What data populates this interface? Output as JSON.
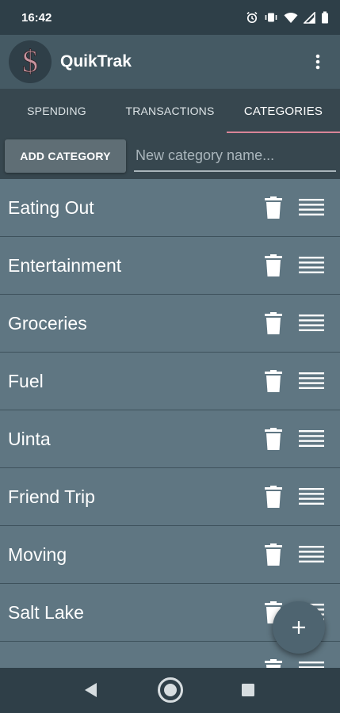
{
  "status_bar": {
    "time": "16:42"
  },
  "app_bar": {
    "title": "QuikTrak",
    "logo_symbol": "$"
  },
  "tabs": [
    {
      "label": "SPENDING",
      "active": false
    },
    {
      "label": "TRANSACTIONS",
      "active": false
    },
    {
      "label": "CATEGORIES",
      "active": true
    }
  ],
  "add_category": {
    "button_label": "ADD CATEGORY",
    "input_placeholder": "New category name...",
    "input_value": ""
  },
  "categories": [
    {
      "name": "Eating Out"
    },
    {
      "name": "Entertainment"
    },
    {
      "name": "Groceries"
    },
    {
      "name": "Fuel"
    },
    {
      "name": "Uinta"
    },
    {
      "name": "Friend Trip"
    },
    {
      "name": "Moving"
    },
    {
      "name": "Salt Lake"
    },
    {
      "name": ""
    }
  ],
  "fab": {
    "symbol": "+"
  },
  "colors": {
    "background": "#5f7682",
    "app_bar": "#455a64",
    "tab_bar": "#37474f",
    "tab_indicator": "#d98497",
    "logo_dollar": "#c7949f"
  }
}
